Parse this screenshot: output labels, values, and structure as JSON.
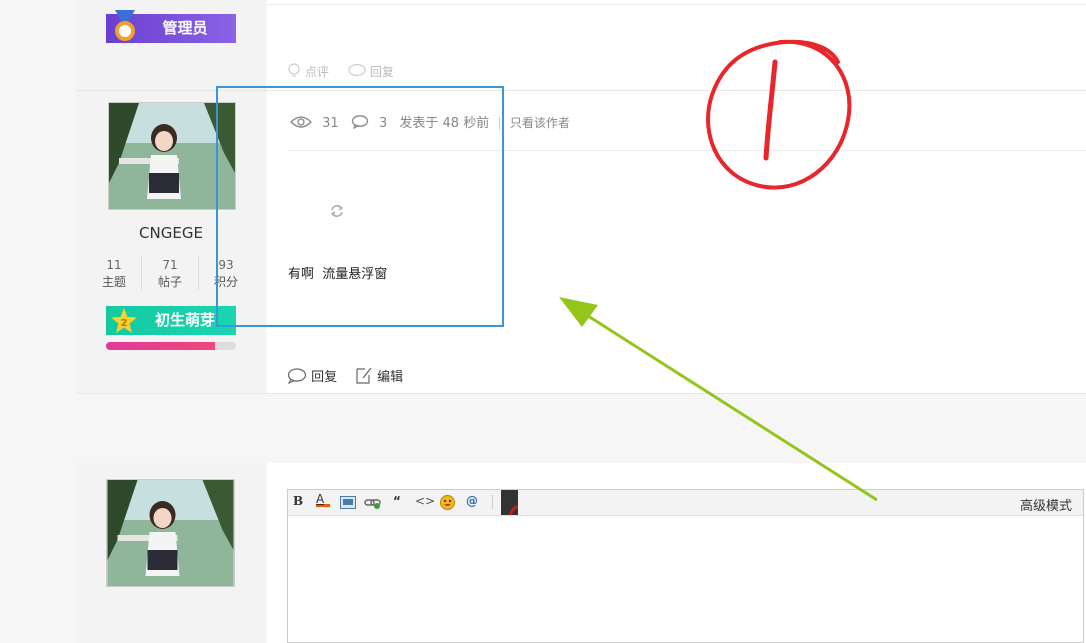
{
  "prev_post": {
    "admin_badge": "管理员",
    "actions": [
      "点评",
      "回复"
    ]
  },
  "post": {
    "username": "CNGEGE",
    "stats": [
      {
        "value": "11",
        "label": "主题"
      },
      {
        "value": "71",
        "label": "帖子"
      },
      {
        "value": "93",
        "label": "积分"
      }
    ],
    "level_badge": "初生萌芽",
    "level_num": "2",
    "progress_fraction": 0.84,
    "views": "31",
    "replies": "3",
    "posted_time": "发表于 48 秒前",
    "only_author": "只看该作者",
    "content": "有啊  流量悬浮窗",
    "actions": {
      "reply": "回复",
      "edit": "编辑"
    }
  },
  "editor": {
    "advanced_mode": "高级模式",
    "toolbar": [
      "B",
      "A",
      "image",
      "link",
      "“",
      "<>",
      "emoji",
      "@"
    ]
  },
  "annotation": {
    "circled_text": "1",
    "box_color": "#3d95d8",
    "arrow_color": "#93c51a",
    "circle_color": "#e8262b"
  }
}
